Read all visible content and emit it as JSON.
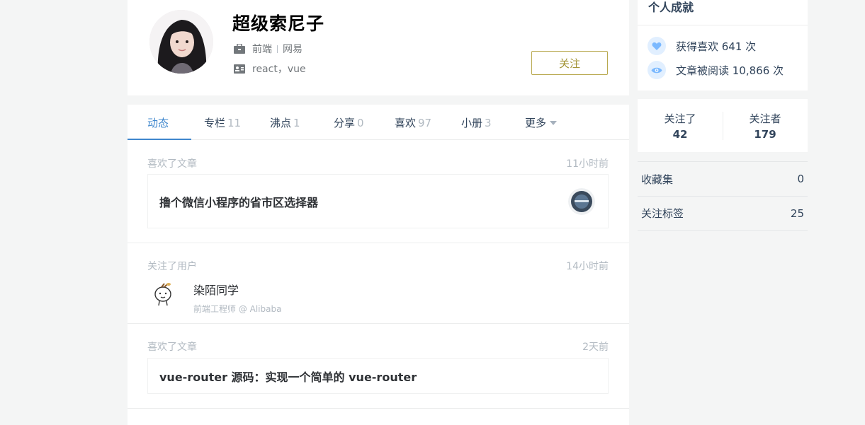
{
  "profile": {
    "name": "超级索尼子",
    "job_title": "前端",
    "company": "网易",
    "intro": "react，vue",
    "follow_button": "关注"
  },
  "tabs": [
    {
      "label": "动态",
      "count": ""
    },
    {
      "label": "专栏",
      "count": "11"
    },
    {
      "label": "沸点",
      "count": "1"
    },
    {
      "label": "分享",
      "count": "0"
    },
    {
      "label": "喜欢",
      "count": "97"
    },
    {
      "label": "小册",
      "count": "3"
    },
    {
      "label": "更多",
      "count": ""
    }
  ],
  "activities": [
    {
      "action": "喜欢了文章",
      "time": "11小时前",
      "title": "撸个微信小程序的省市区选择器"
    },
    {
      "action": "关注了用户",
      "time": "14小时前",
      "user_name": "染陌同学",
      "user_desc": "前端工程师 @ Alibaba"
    },
    {
      "action": "喜欢了文章",
      "time": "2天前",
      "title": "vue-router 源码：实现一个简单的 vue-router"
    }
  ],
  "achievements": {
    "title": "个人成就",
    "likes": "获得喜欢 641 次",
    "reads": "文章被阅读 10,866 次"
  },
  "follow_stats": {
    "following_label": "关注了",
    "following_count": "42",
    "followers_label": "关注者",
    "followers_count": "179"
  },
  "side_links": [
    {
      "label": "收藏集",
      "value": "0"
    },
    {
      "label": "关注标签",
      "value": "25"
    }
  ],
  "colors": {
    "accent_blue": "#3f87cd",
    "follow_gold": "#b8a94f",
    "page_bg": "#f4f5f5"
  }
}
